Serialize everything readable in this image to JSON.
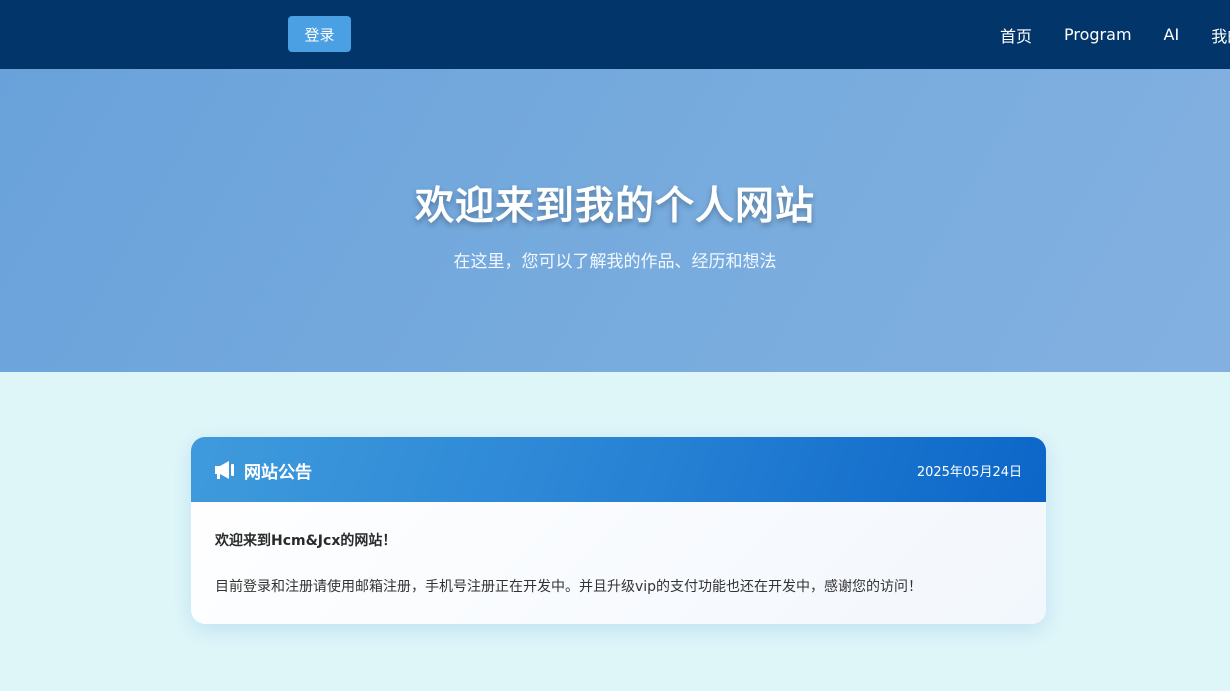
{
  "navbar": {
    "login_label": "登录",
    "links": [
      "首页",
      "Program",
      "AI",
      "我的"
    ]
  },
  "hero": {
    "title": "欢迎来到我的个人网站",
    "subtitle": "在这里，您可以了解我的作品、经历和想法"
  },
  "notice": {
    "icon": "megaphone-icon",
    "title": "网站公告",
    "date": "2025年05月24日",
    "welcome": "欢迎来到Hcm&Jcx的网站！",
    "text": "目前登录和注册请使用邮箱注册，手机号注册正在开发中。并且升级vip的支付功能也还在开发中，感谢您的访问！"
  },
  "colors": {
    "navbar": "#02366a",
    "login_button": "#4aa0e2",
    "hero": "#72a8dd",
    "page_background": "#dff6f9",
    "notice_header": "#2c86d6"
  }
}
